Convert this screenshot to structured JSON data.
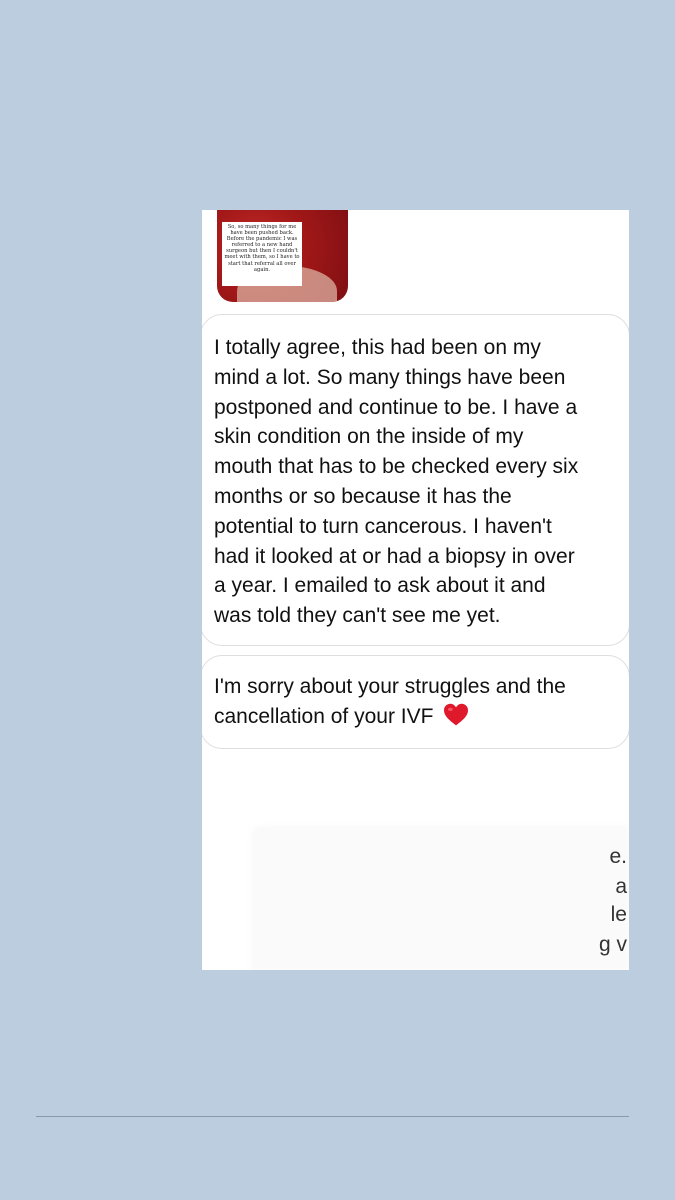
{
  "image_note": "So, so many things for me have been pushed back. Before the pandemic I was referred to a new hand surgeon but then I couldn't meet with them, so I have to start that referral all over again.",
  "messages": [
    {
      "lines": [
        "I totally agree, this had been on my",
        "mind a lot. So many things have been",
        "postponed and continue to be. I have a",
        "skin condition on the inside of my",
        "mouth that has to be checked every six",
        "months or so because it has the",
        "potential to turn cancerous. I haven't",
        "had it looked at or had a biopsy in over",
        "a year. I emailed to ask about it and",
        "was told they can't see me yet."
      ]
    },
    {
      "lines": [
        "I'm sorry about your struggles and the",
        "cancellation of your IVF"
      ],
      "emoji": "heart-emoji"
    }
  ],
  "redacted_fragments": [
    "e.",
    "a",
    "le",
    "g v"
  ],
  "colors": {
    "background": "#bccddf",
    "bubble_border": "#dedede",
    "heart": "#e0182c"
  }
}
